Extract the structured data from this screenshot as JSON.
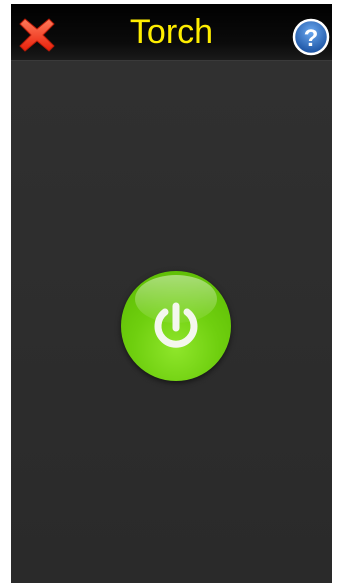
{
  "header": {
    "title": "Torch",
    "title_color": "#ffee00",
    "close_icon": "close-icon",
    "help_icon": "help-icon"
  },
  "main": {
    "power_icon": "power-icon",
    "power_button_color": "#6fcf0f"
  },
  "colors": {
    "background": "#2d2d2d",
    "header_background": "#050505",
    "close_red": "#ff3b1f",
    "help_blue": "#1f5fbf"
  }
}
